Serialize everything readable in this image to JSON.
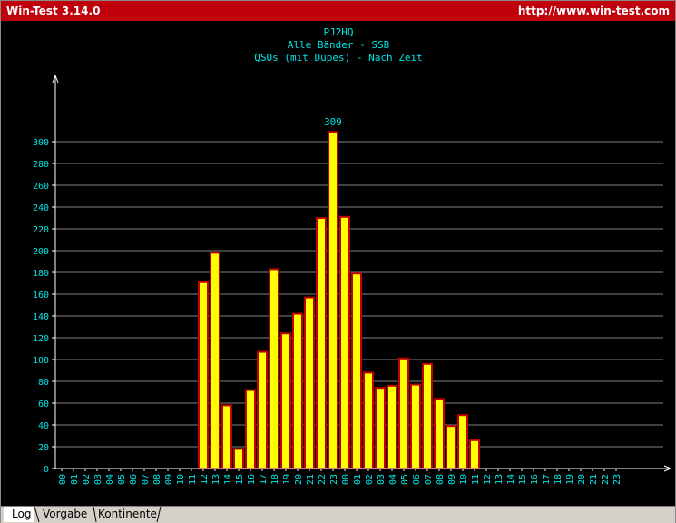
{
  "window": {
    "title": "Win-Test 3.14.0",
    "url": "http://www.win-test.com"
  },
  "tabs": [
    {
      "label": "Log",
      "active": true
    },
    {
      "label": "Vorgabe",
      "active": false
    },
    {
      "label": "Kontinente",
      "active": false
    }
  ],
  "colors": {
    "background": "#000000",
    "text": "#00e5e5",
    "bar_fill": "#ffff00",
    "bar_edge": "#c00000",
    "grid": "#808080",
    "axis": "#ffffff",
    "titlebar": "#c0000a"
  },
  "chart_data": {
    "type": "bar",
    "title": "PJ2HQ",
    "subtitle": "Alle Bänder - SSB",
    "subtitle2": "QSOs (mit Dupes) - Nach Zeit",
    "xlabel": "",
    "ylabel": "",
    "ylim": [
      0,
      320
    ],
    "yticks": [
      0,
      20,
      40,
      60,
      80,
      100,
      120,
      140,
      160,
      180,
      200,
      220,
      240,
      260,
      280,
      300
    ],
    "grid": true,
    "max_label": "309",
    "categories": [
      "00",
      "01",
      "02",
      "03",
      "04",
      "05",
      "06",
      "07",
      "08",
      "09",
      "10",
      "11",
      "12",
      "13",
      "14",
      "15",
      "16",
      "17",
      "18",
      "19",
      "20",
      "21",
      "22",
      "23",
      "00",
      "01",
      "02",
      "03",
      "04",
      "05",
      "06",
      "07",
      "08",
      "09",
      "10",
      "11",
      "12",
      "13",
      "14",
      "15",
      "16",
      "17",
      "18",
      "19",
      "20",
      "21",
      "22",
      "23"
    ],
    "values": [
      0,
      0,
      0,
      0,
      0,
      0,
      0,
      0,
      0,
      0,
      0,
      0,
      171,
      198,
      58,
      18,
      72,
      107,
      183,
      124,
      142,
      157,
      230,
      309,
      231,
      179,
      88,
      74,
      76,
      101,
      77,
      96,
      64,
      39,
      49,
      26,
      0,
      0,
      0,
      0,
      0,
      0,
      0,
      0,
      0,
      0,
      0,
      0
    ]
  }
}
